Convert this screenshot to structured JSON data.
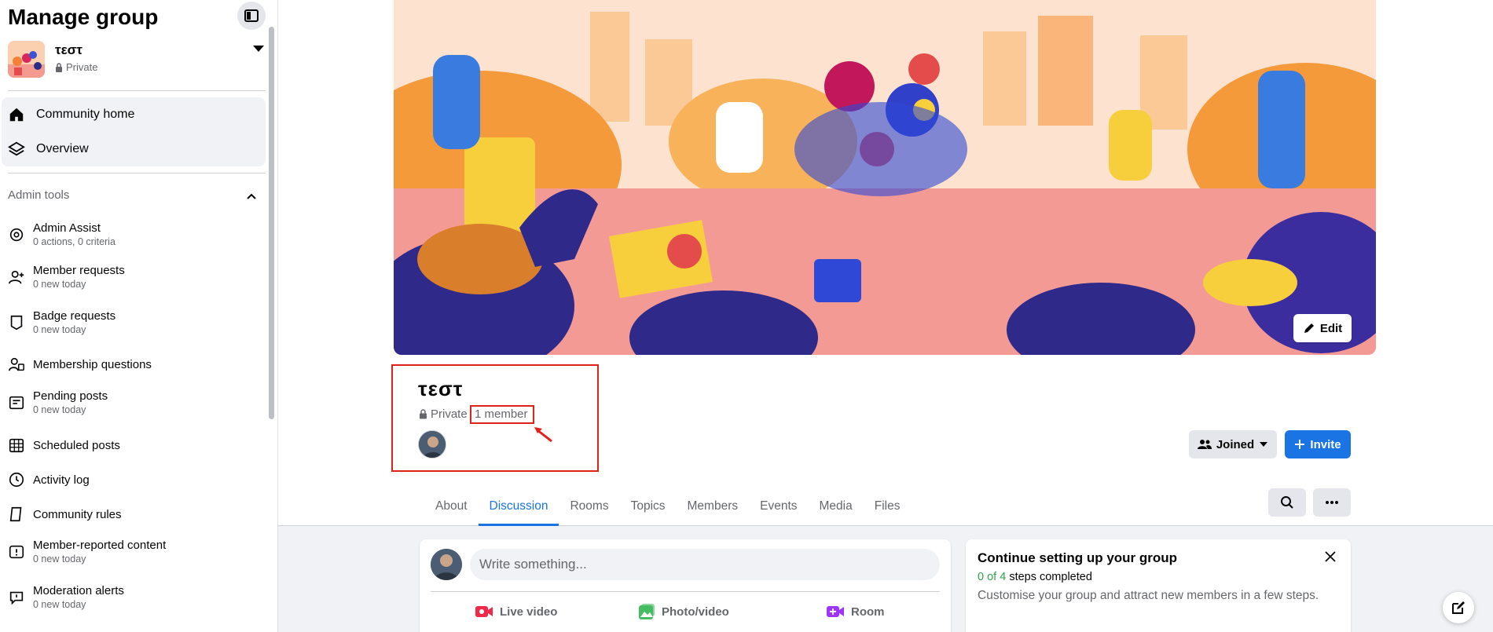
{
  "sidebar": {
    "title": "Manage group",
    "group": {
      "name": "τεστ",
      "privacy": "Private"
    },
    "nav": [
      {
        "label": "Community home",
        "icon": "home-icon"
      },
      {
        "label": "Overview",
        "icon": "layers-icon"
      }
    ],
    "admin_tools_header": "Admin tools",
    "tools": [
      {
        "label": "Admin Assist",
        "sub": "0 actions, 0 criteria",
        "icon": "admin-assist-icon"
      },
      {
        "label": "Member requests",
        "sub": "0 new today",
        "icon": "member-requests-icon"
      },
      {
        "label": "Badge requests",
        "sub": "0 new today",
        "icon": "badge-icon"
      },
      {
        "label": "Membership questions",
        "sub": "",
        "icon": "questions-icon"
      },
      {
        "label": "Pending posts",
        "sub": "0 new today",
        "icon": "pending-posts-icon"
      },
      {
        "label": "Scheduled posts",
        "sub": "",
        "icon": "calendar-icon"
      },
      {
        "label": "Activity log",
        "sub": "",
        "icon": "clock-icon"
      },
      {
        "label": "Community rules",
        "sub": "",
        "icon": "rules-icon"
      },
      {
        "label": "Member-reported content",
        "sub": "0 new today",
        "icon": "report-icon"
      },
      {
        "label": "Moderation alerts",
        "sub": "0 new today",
        "icon": "alert-icon"
      }
    ]
  },
  "cover": {
    "edit_label": "Edit"
  },
  "group": {
    "title": "τεστ",
    "privacy": "Private",
    "members": "1 member"
  },
  "actions": {
    "joined": "Joined",
    "invite": "Invite"
  },
  "tabs": [
    "About",
    "Discussion",
    "Rooms",
    "Topics",
    "Members",
    "Events",
    "Media",
    "Files"
  ],
  "active_tab": "Discussion",
  "composer": {
    "placeholder": "Write something...",
    "live": "Live video",
    "photo": "Photo/video",
    "room": "Room"
  },
  "setup": {
    "title": "Continue setting up your group",
    "steps_done": "0 of 4",
    "steps_suffix": "steps completed",
    "description": "Customise your group and attract new members in a few steps."
  },
  "colors": {
    "accent": "#1b74e4",
    "highlight": "#e1201a",
    "green": "#31a24c"
  }
}
